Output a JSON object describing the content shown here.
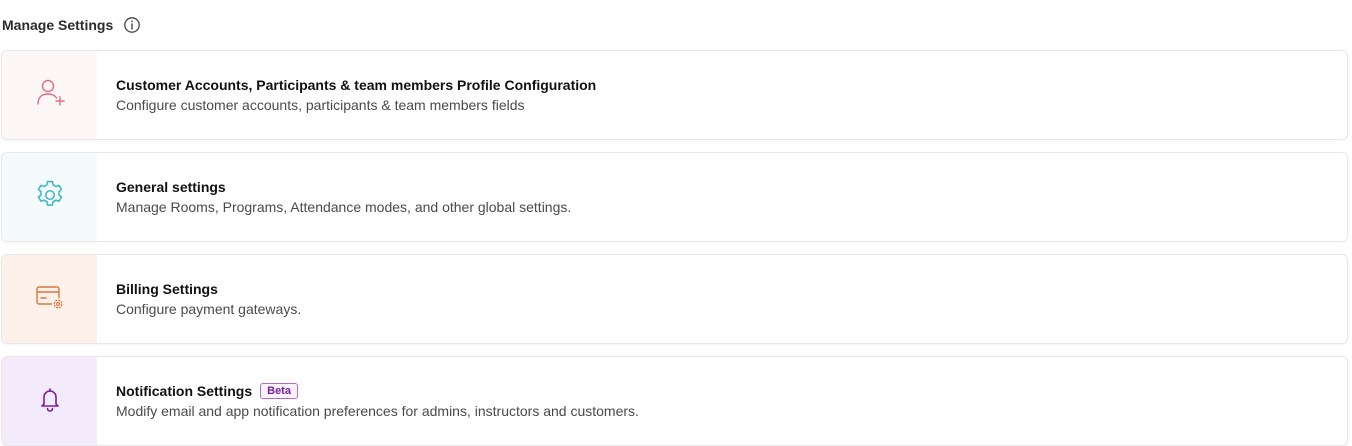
{
  "header": {
    "title": "Manage Settings",
    "info_icon": "info-icon"
  },
  "colors": {
    "customer_icon": "#e06b8a",
    "general_icon": "#3fb7c9",
    "billing_icon": "#d9763f",
    "notification_icon": "#7a1fa2"
  },
  "cards": [
    {
      "icon": "user-add-icon",
      "title": "Customer Accounts, Participants & team members Profile Configuration",
      "description": "Configure customer accounts, participants & team members fields"
    },
    {
      "icon": "gear-icon",
      "title": "General settings",
      "description": "Manage Rooms, Programs, Attendance modes, and other global settings."
    },
    {
      "icon": "billing-settings-icon",
      "title": "Billing Settings",
      "description": "Configure payment gateways."
    },
    {
      "icon": "bell-icon",
      "title": "Notification Settings",
      "badge": "Beta",
      "description": "Modify email and app notification preferences for admins, instructors and customers."
    }
  ]
}
